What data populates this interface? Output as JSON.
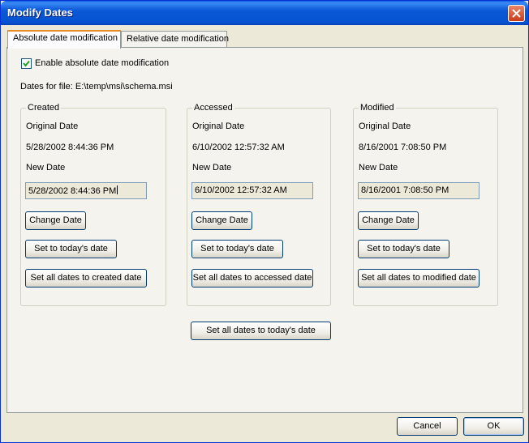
{
  "window": {
    "title": "Modify Dates"
  },
  "tabs": [
    {
      "label": "Absolute date modification",
      "active": true
    },
    {
      "label": "Relative date modification",
      "active": false
    }
  ],
  "enable_checkbox": {
    "label": "Enable absolute date modification",
    "checked": true
  },
  "file_label": "Dates for file: E:\\temp\\msi\\schema.msi",
  "groups": {
    "created": {
      "title": "Created",
      "original_label": "Original Date",
      "original_value": "5/28/2002 8:44:36 PM",
      "new_label": "New Date",
      "new_value": "5/28/2002 8:44:36 PM",
      "change_button": "Change Date",
      "today_button": "Set to today's date",
      "set_all_button": "Set all dates to created date"
    },
    "accessed": {
      "title": "Accessed",
      "original_label": "Original Date",
      "original_value": "6/10/2002 12:57:32 AM",
      "new_label": "New Date",
      "new_value": "6/10/2002 12:57:32 AM",
      "change_button": "Change Date",
      "today_button": "Set to today's date",
      "set_all_button": "Set all dates to accessed date"
    },
    "modified": {
      "title": "Modified",
      "original_label": "Original Date",
      "original_value": "8/16/2001 7:08:50 PM",
      "new_label": "New Date",
      "new_value": "8/16/2001 7:08:50 PM",
      "change_button": "Change Date",
      "today_button": "Set to today's date",
      "set_all_button": "Set all dates to modified date"
    }
  },
  "all_today_button": "Set all dates to today's date",
  "footer": {
    "cancel": "Cancel",
    "ok": "OK"
  },
  "colors": {
    "titlebar": "#0a58d6",
    "active_tab_accent": "#e68b2c",
    "window_bg": "#ece9d8"
  },
  "icons": {
    "close": "close-icon",
    "check": "checkmark-icon"
  }
}
